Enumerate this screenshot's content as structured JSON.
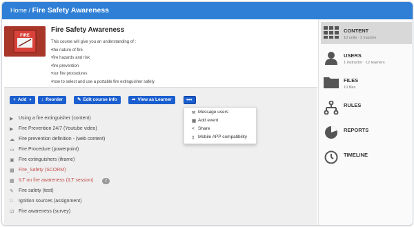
{
  "breadcrumb": {
    "home": "Home",
    "sep": " / ",
    "current": "Fire Safety Awareness"
  },
  "course": {
    "title": "Fire Safety Awareness",
    "thumbnail_text": "FIRE",
    "description": [
      "This course will give you an understanding of :",
      "•the nature of fire",
      "•fire hazards and risk",
      "•fire prevention",
      "•our fire procedures",
      "•how to select and use a portable fire extinguisher safely"
    ]
  },
  "toolbar": {
    "add": "Add",
    "reorder": "Reorder",
    "edit_info": "Edit course info",
    "view_as_learner": "View as Learner",
    "more": "•••"
  },
  "dropdown": [
    {
      "icon": "envelope-icon",
      "label": "Message users"
    },
    {
      "icon": "calendar-icon",
      "label": "Add event"
    },
    {
      "icon": "share-icon",
      "label": "Share"
    },
    {
      "icon": "mobile-icon",
      "label": "Mobile APP compatibility"
    }
  ],
  "units": [
    {
      "icon": "video-icon",
      "label": "Using a fire extinguisher (content)",
      "highlight": false
    },
    {
      "icon": "video-icon",
      "label": "Fire Prevention 24/7 (Youtube video)",
      "highlight": false
    },
    {
      "icon": "cloud-icon",
      "label": "Fire prevention definition - (web content)",
      "highlight": false
    },
    {
      "icon": "presentation-icon",
      "label": "Fire Procedure (powerpoint)",
      "highlight": false
    },
    {
      "icon": "frame-icon",
      "label": "Fire extinguishers (iframe)",
      "highlight": false
    },
    {
      "icon": "scorm-icon",
      "label": "Fire_Safety (SCORM)",
      "highlight": true
    },
    {
      "icon": "calendar-icon",
      "label": "ILT on fire awareness (ILT session)",
      "highlight": true,
      "badge": "2"
    },
    {
      "icon": "test-icon",
      "label": "Fire safety (test)",
      "highlight": false
    },
    {
      "icon": "assignment-icon",
      "label": "Ignition sources (assignment)",
      "highlight": false
    },
    {
      "icon": "survey-icon",
      "label": "Fire awareness (survey)",
      "highlight": false
    }
  ],
  "sidebar": [
    {
      "icon": "grid-icon",
      "label": "CONTENT",
      "sub": "10 units · 2 inactive",
      "active": true
    },
    {
      "icon": "user-icon",
      "label": "USERS",
      "sub": "1 instructor · 12 learners",
      "active": false
    },
    {
      "icon": "folder-icon",
      "label": "FILES",
      "sub": "10 files",
      "active": false
    },
    {
      "icon": "rules-icon",
      "label": "RULES",
      "sub": "",
      "active": false
    },
    {
      "icon": "pie-chart-icon",
      "label": "REPORTS",
      "sub": "",
      "active": false
    },
    {
      "icon": "clock-icon",
      "label": "TIMELINE",
      "sub": "",
      "active": false
    }
  ],
  "colors": {
    "topbar": "#2f7fd6",
    "button": "#1b5fcf",
    "highlight": "#c0504d"
  }
}
